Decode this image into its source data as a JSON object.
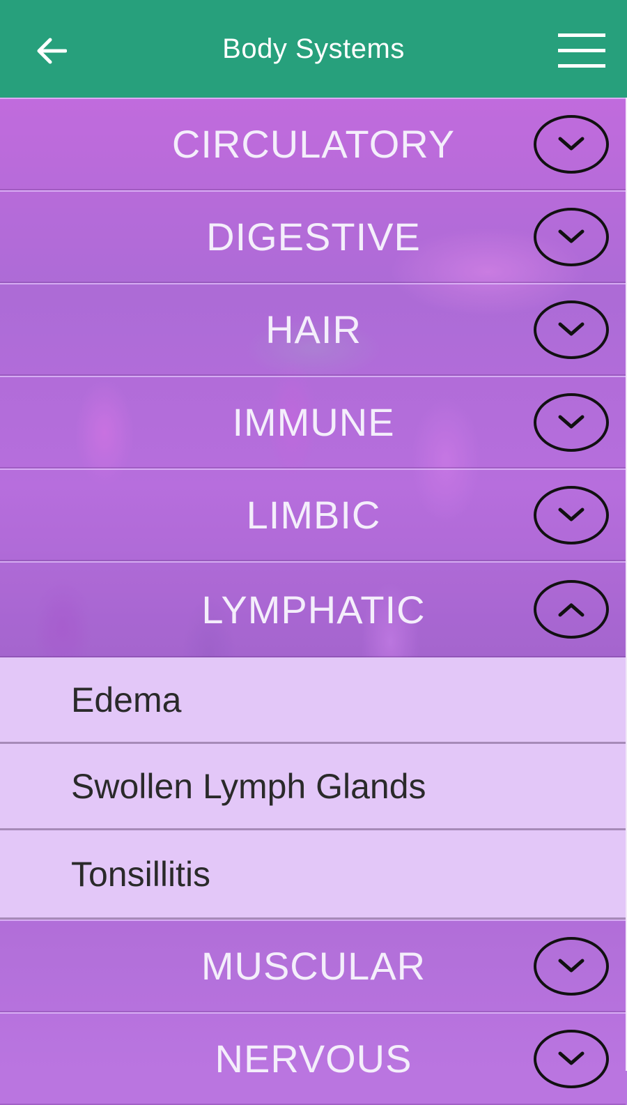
{
  "app_bar": {
    "title": "Body Systems",
    "back_icon": "arrow-left-icon",
    "menu_icon": "hamburger-menu-icon",
    "color": "#27a07c"
  },
  "groups": [
    {
      "label": "CIRCULATORY",
      "expanded": false
    },
    {
      "label": "DIGESTIVE",
      "expanded": false
    },
    {
      "label": "HAIR",
      "expanded": false
    },
    {
      "label": "IMMUNE",
      "expanded": false
    },
    {
      "label": "LIMBIC",
      "expanded": false
    },
    {
      "label": "LYMPHATIC",
      "expanded": true,
      "children": [
        "Edema",
        "Swollen Lymph Glands",
        "Tonsillitis"
      ]
    },
    {
      "label": "MUSCULAR",
      "expanded": false
    },
    {
      "label": "NERVOUS",
      "expanded": false
    }
  ],
  "colors": {
    "child_background": "#e3c7f8",
    "group_text": "#f4eefb"
  }
}
